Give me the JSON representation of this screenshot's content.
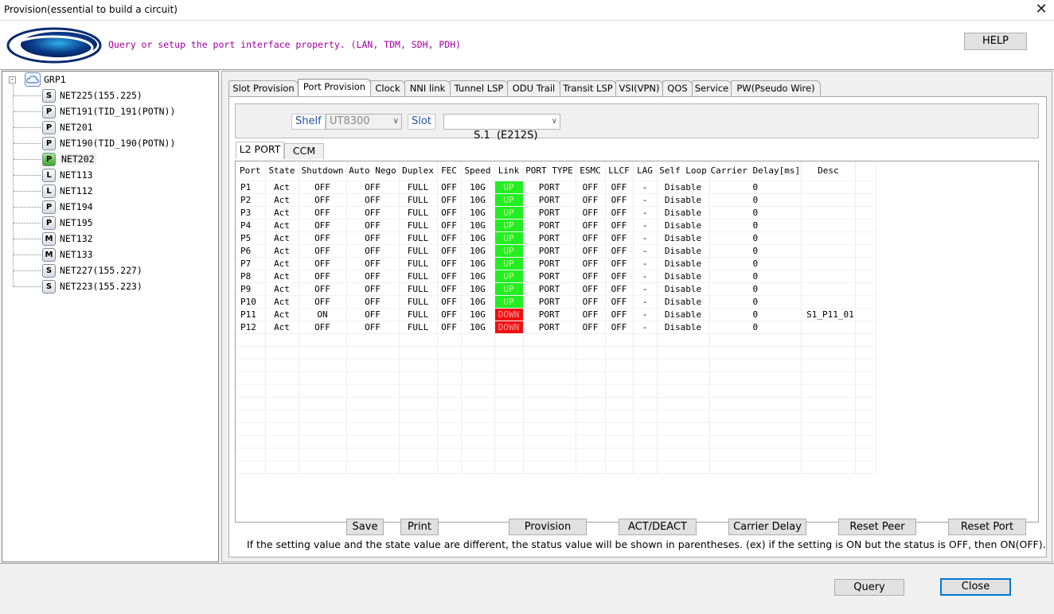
{
  "window": {
    "title": "Provision(essential to build a circuit)"
  },
  "header": {
    "description": "Query or setup the port interface property. (LAN, TDM, SDH, PDH)",
    "help_label": "HELP"
  },
  "tree": {
    "root": "GRP1",
    "nodes": [
      {
        "badge": "S",
        "label": "NET225(155.225)",
        "icon": "s-node-icon"
      },
      {
        "badge": "P",
        "label": "NET191(TID_191(POTN))",
        "icon": "p-node-icon"
      },
      {
        "badge": "P",
        "label": "NET201",
        "icon": "p-node-icon"
      },
      {
        "badge": "P",
        "label": "NET190(TID_190(POTN))",
        "icon": "p-node-icon"
      },
      {
        "badge": "P",
        "label": "NET202",
        "icon": "p-node-green-icon",
        "selected": true
      },
      {
        "badge": "L",
        "label": "NET113",
        "icon": "l-node-icon"
      },
      {
        "badge": "L",
        "label": "NET112",
        "icon": "l-node-icon"
      },
      {
        "badge": "P",
        "label": "NET194",
        "icon": "p-node-icon"
      },
      {
        "badge": "P",
        "label": "NET195",
        "icon": "p-node-icon"
      },
      {
        "badge": "M",
        "label": "NET132",
        "icon": "m-node-icon"
      },
      {
        "badge": "M",
        "label": "NET133",
        "icon": "m-node-icon"
      },
      {
        "badge": "S",
        "label": "NET227(155.227)",
        "icon": "s-node-icon"
      },
      {
        "badge": "S",
        "label": "NET223(155.223)",
        "icon": "s-node-icon"
      }
    ]
  },
  "tabs": [
    "Slot Provision",
    "Port Provision",
    "Clock",
    "NNI link",
    "Tunnel LSP",
    "ODU Trail",
    "Transit LSP",
    "VSI(VPN)",
    "QOS",
    "Service",
    "PW(Pseudo Wire)"
  ],
  "active_tab": "Port Provision",
  "shelf": {
    "label": "Shelf",
    "value": "UT8300"
  },
  "slot": {
    "label": "Slot",
    "value": "S.1  (E212S)"
  },
  "subtabs": [
    "L2 PORT",
    "CCM"
  ],
  "table": {
    "columns": [
      "Port",
      "State",
      "Shutdown",
      "Auto Nego",
      "Duplex",
      "FEC",
      "Speed",
      "Link",
      "PORT TYPE",
      "ESMC",
      "LLCF",
      "LAG",
      "Self Loop",
      "Carrier Delay[ms]",
      "Desc"
    ],
    "rows": [
      [
        "P1",
        "Act",
        "OFF",
        "OFF",
        "FULL",
        "OFF",
        "10G",
        "UP",
        "PORT",
        "OFF",
        "OFF",
        "-",
        "Disable",
        "0",
        ""
      ],
      [
        "P2",
        "Act",
        "OFF",
        "OFF",
        "FULL",
        "OFF",
        "10G",
        "UP",
        "PORT",
        "OFF",
        "OFF",
        "-",
        "Disable",
        "0",
        ""
      ],
      [
        "P3",
        "Act",
        "OFF",
        "OFF",
        "FULL",
        "OFF",
        "10G",
        "UP",
        "PORT",
        "OFF",
        "OFF",
        "-",
        "Disable",
        "0",
        ""
      ],
      [
        "P4",
        "Act",
        "OFF",
        "OFF",
        "FULL",
        "OFF",
        "10G",
        "UP",
        "PORT",
        "OFF",
        "OFF",
        "-",
        "Disable",
        "0",
        ""
      ],
      [
        "P5",
        "Act",
        "OFF",
        "OFF",
        "FULL",
        "OFF",
        "10G",
        "UP",
        "PORT",
        "OFF",
        "OFF",
        "-",
        "Disable",
        "0",
        ""
      ],
      [
        "P6",
        "Act",
        "OFF",
        "OFF",
        "FULL",
        "OFF",
        "10G",
        "UP",
        "PORT",
        "OFF",
        "OFF",
        "-",
        "Disable",
        "0",
        ""
      ],
      [
        "P7",
        "Act",
        "OFF",
        "OFF",
        "FULL",
        "OFF",
        "10G",
        "UP",
        "PORT",
        "OFF",
        "OFF",
        "-",
        "Disable",
        "0",
        ""
      ],
      [
        "P8",
        "Act",
        "OFF",
        "OFF",
        "FULL",
        "OFF",
        "10G",
        "UP",
        "PORT",
        "OFF",
        "OFF",
        "-",
        "Disable",
        "0",
        ""
      ],
      [
        "P9",
        "Act",
        "OFF",
        "OFF",
        "FULL",
        "OFF",
        "10G",
        "UP",
        "PORT",
        "OFF",
        "OFF",
        "-",
        "Disable",
        "0",
        ""
      ],
      [
        "P10",
        "Act",
        "OFF",
        "OFF",
        "FULL",
        "OFF",
        "10G",
        "UP",
        "PORT",
        "OFF",
        "OFF",
        "-",
        "Disable",
        "0",
        ""
      ],
      [
        "P11",
        "Act",
        "ON",
        "OFF",
        "FULL",
        "OFF",
        "10G",
        "DOWN",
        "PORT",
        "OFF",
        "OFF",
        "-",
        "Disable",
        "0",
        "S1_P11_01"
      ],
      [
        "P12",
        "Act",
        "OFF",
        "OFF",
        "FULL",
        "OFF",
        "10G",
        "DOWN",
        "PORT",
        "OFF",
        "OFF",
        "-",
        "Disable",
        "0",
        ""
      ]
    ],
    "link_colors": {
      "UP": "#22ee22",
      "DOWN": "#ee1111"
    }
  },
  "actions": {
    "save": "Save",
    "print": "Print",
    "provision": "Provision",
    "act_deact": "ACT/DEACT",
    "carrier_delay": "Carrier Delay",
    "reset_peer": "Reset Peer",
    "reset_port": "Reset Port"
  },
  "note": "If the setting value and the state value are different, the status value will be shown in parentheses. (ex) if the setting is ON but the status is OFF, then ON(OFF).",
  "footer": {
    "query": "Query",
    "close": "Close"
  }
}
